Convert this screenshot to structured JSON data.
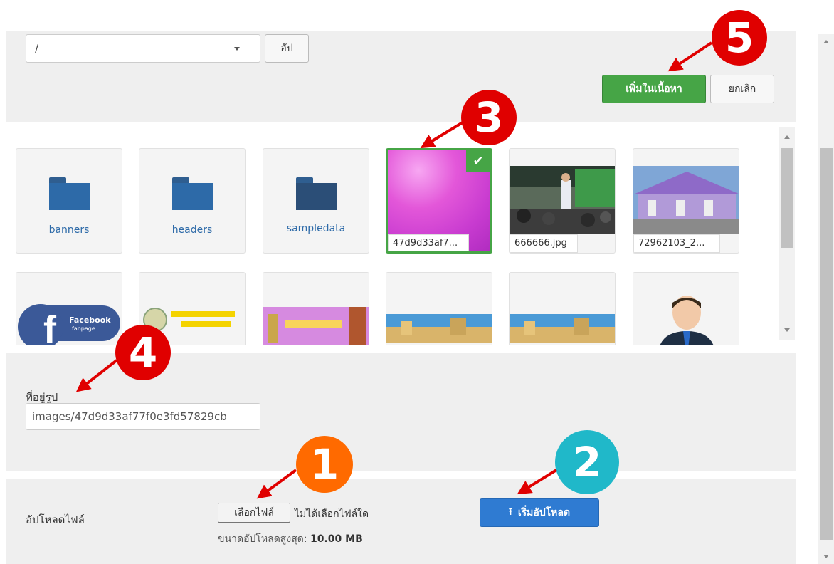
{
  "toolbar": {
    "folder_value": "/",
    "up_label": "อัป",
    "insert_label": "เพิ่มในเนื้อหา",
    "cancel_label": "ยกเลิก"
  },
  "folders": [
    {
      "name": "banners"
    },
    {
      "name": "headers"
    },
    {
      "name": "sampledata"
    }
  ],
  "images": [
    {
      "label": "47d9d33af7..."
    },
    {
      "label": "666666.jpg"
    },
    {
      "label": "72962103_2..."
    }
  ],
  "row2": {
    "facebook_text": "Facebook",
    "fanpage_text": "fanpage"
  },
  "url_section": {
    "label": "ที่อยู่รูป",
    "value": "images/47d9d33af77f0e3fd57829cb"
  },
  "upload_section": {
    "label": "อัปโหลดไฟล์",
    "choose_file": "เลือกไฟล์",
    "no_file": "ไม่ได้เลือกไฟล์ใด",
    "max_label": "ขนาดอัปโหลดสูงสุด: ",
    "max_value": "10.00 MB",
    "start_label": "เริ่มอัปโหลด"
  },
  "badges": {
    "one": "1",
    "two": "2",
    "three": "3",
    "four": "4",
    "five": "5"
  },
  "colors": {
    "success": "#46a546",
    "primary": "#2f7bd2",
    "annotation_red": "#e00000"
  }
}
